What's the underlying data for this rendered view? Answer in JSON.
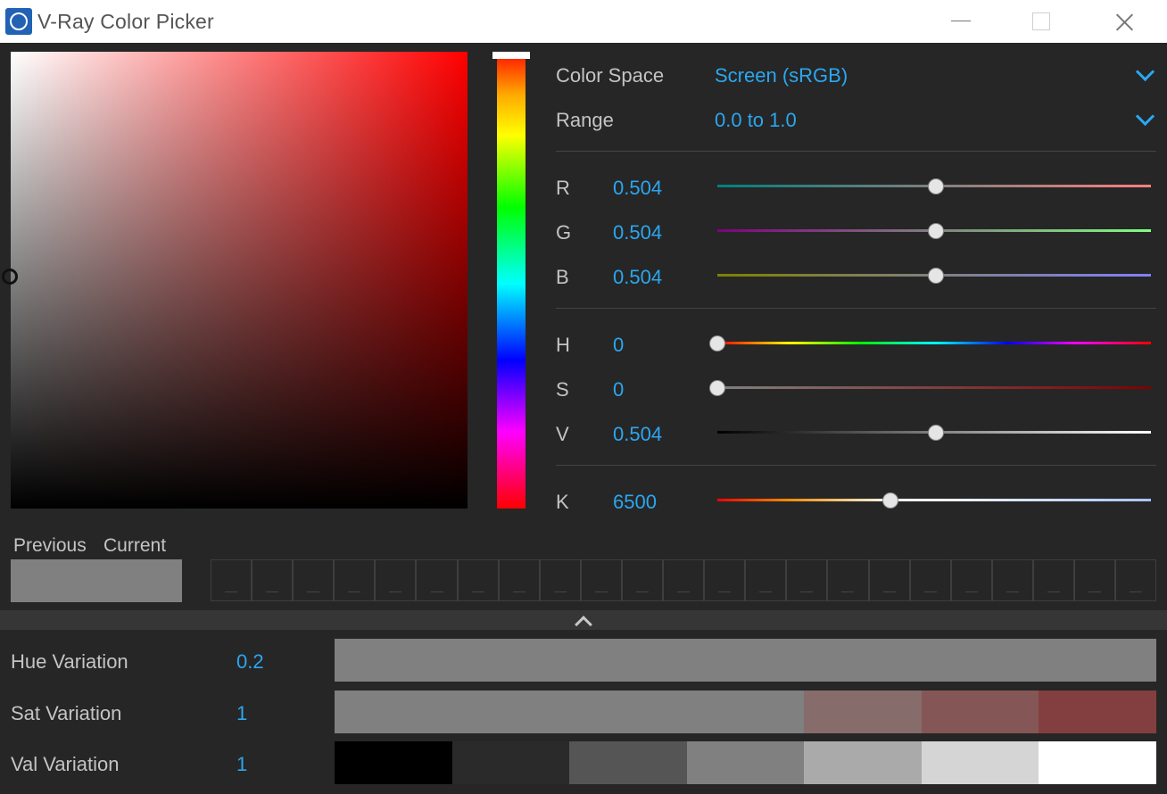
{
  "window": {
    "title": "V-Ray Color Picker"
  },
  "icons": {
    "app": "vray-logo-icon",
    "minimize": "minimize-icon",
    "maximize": "maximize-icon",
    "close": "close-icon",
    "dropdown": "chevron-down-icon",
    "collapse": "chevron-up-icon"
  },
  "color_space": {
    "label": "Color Space",
    "value": "Screen (sRGB)"
  },
  "range": {
    "label": "Range",
    "value": "0.0 to 1.0"
  },
  "channels": {
    "r": {
      "label": "R",
      "value": "0.504",
      "level": 0.504
    },
    "g": {
      "label": "G",
      "value": "0.504",
      "level": 0.504
    },
    "b": {
      "label": "B",
      "value": "0.504",
      "level": 0.504
    },
    "h": {
      "label": "H",
      "value": "0",
      "level": 0
    },
    "s": {
      "label": "S",
      "value": "0",
      "level": 0
    },
    "v": {
      "label": "V",
      "value": "0.504",
      "level": 0.504
    },
    "k": {
      "label": "K",
      "value": "6500",
      "level": 0.4
    }
  },
  "swatches": {
    "previous_label": "Previous",
    "current_label": "Current",
    "previous_color": "#808080",
    "current_color": "#808080"
  },
  "palette": {
    "slots": 23
  },
  "variations": {
    "hue": {
      "label": "Hue Variation",
      "value": "0.2",
      "colors": [
        "#808080",
        "#808080",
        "#808080",
        "#808080",
        "#808080",
        "#808080",
        "#808080"
      ]
    },
    "sat": {
      "label": "Sat Variation",
      "value": "1",
      "colors": [
        "#808080",
        "#808080",
        "#808080",
        "#808080",
        "#876c6c",
        "#855656",
        "#833f3f"
      ]
    },
    "val": {
      "label": "Val Variation",
      "value": "1",
      "colors": [
        "#000000",
        "#2a2a2a",
        "#555555",
        "#808080",
        "#aaaaaa",
        "#d5d5d5",
        "#ffffff"
      ]
    }
  },
  "colors": {
    "accent": "#2ba7f0",
    "background": "#262626",
    "label_text": "#c4c4c4"
  }
}
